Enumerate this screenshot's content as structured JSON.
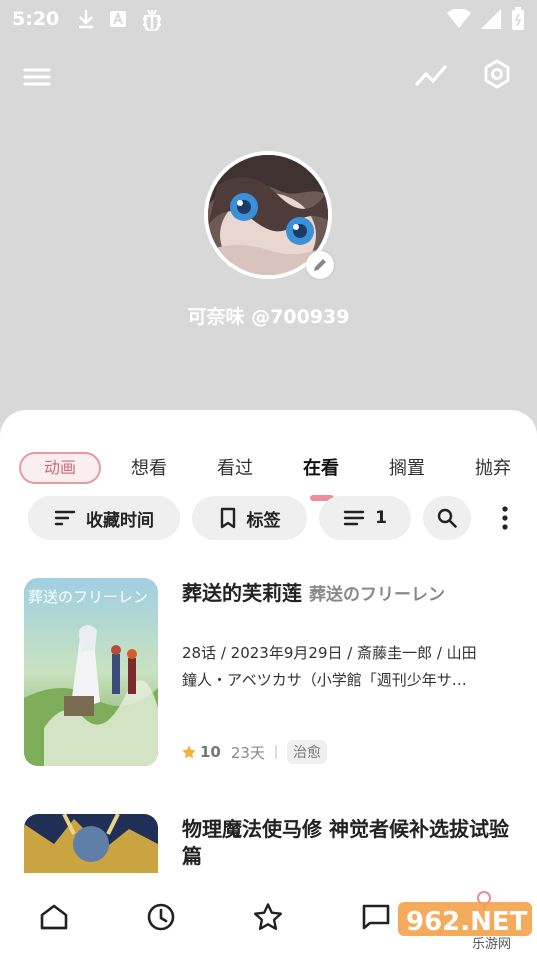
{
  "status_bar": {
    "time": "5:20"
  },
  "profile": {
    "username": "可奈味 @700939"
  },
  "tabs": {
    "type_label": "动画",
    "items": [
      "想看",
      "看过",
      "在看",
      "搁置",
      "抛弃"
    ],
    "active": "在看"
  },
  "filters": {
    "sort_label": "收藏时间",
    "tag_label": "标签",
    "list_count": "1"
  },
  "items": [
    {
      "title": "葬送的芙莉莲",
      "original_title": "葬送のフリーレン",
      "desc_line1": "28话 / 2023年9月29日 / 斎藤圭一郎 / 山田",
      "desc_line2": "鐘人・アベツカサ（小学館「週刊少年サ…",
      "score": "10",
      "days": "23天",
      "tag": "治愈",
      "cover_text": "葬送のフリーレン"
    },
    {
      "title": "物理魔法使马修 神觉者候补选拔试验篇"
    }
  ],
  "watermark": {
    "text": "962.NET",
    "sub": "乐游网"
  },
  "colors": {
    "accent": "#ee8e9a",
    "star": "#f3b23a",
    "header_bg": "#d8d8d8"
  },
  "icons": [
    "download-icon",
    "a-notification-icon",
    "bug-icon",
    "wifi-icon",
    "battery-icon",
    "menu-icon",
    "trend-icon",
    "settings-icon",
    "edit-icon",
    "sort-icon",
    "bookmark-icon",
    "list-icon",
    "search-icon",
    "more-vertical-icon",
    "star-icon",
    "home-icon",
    "clock-icon",
    "star-outline-icon",
    "message-icon"
  ]
}
